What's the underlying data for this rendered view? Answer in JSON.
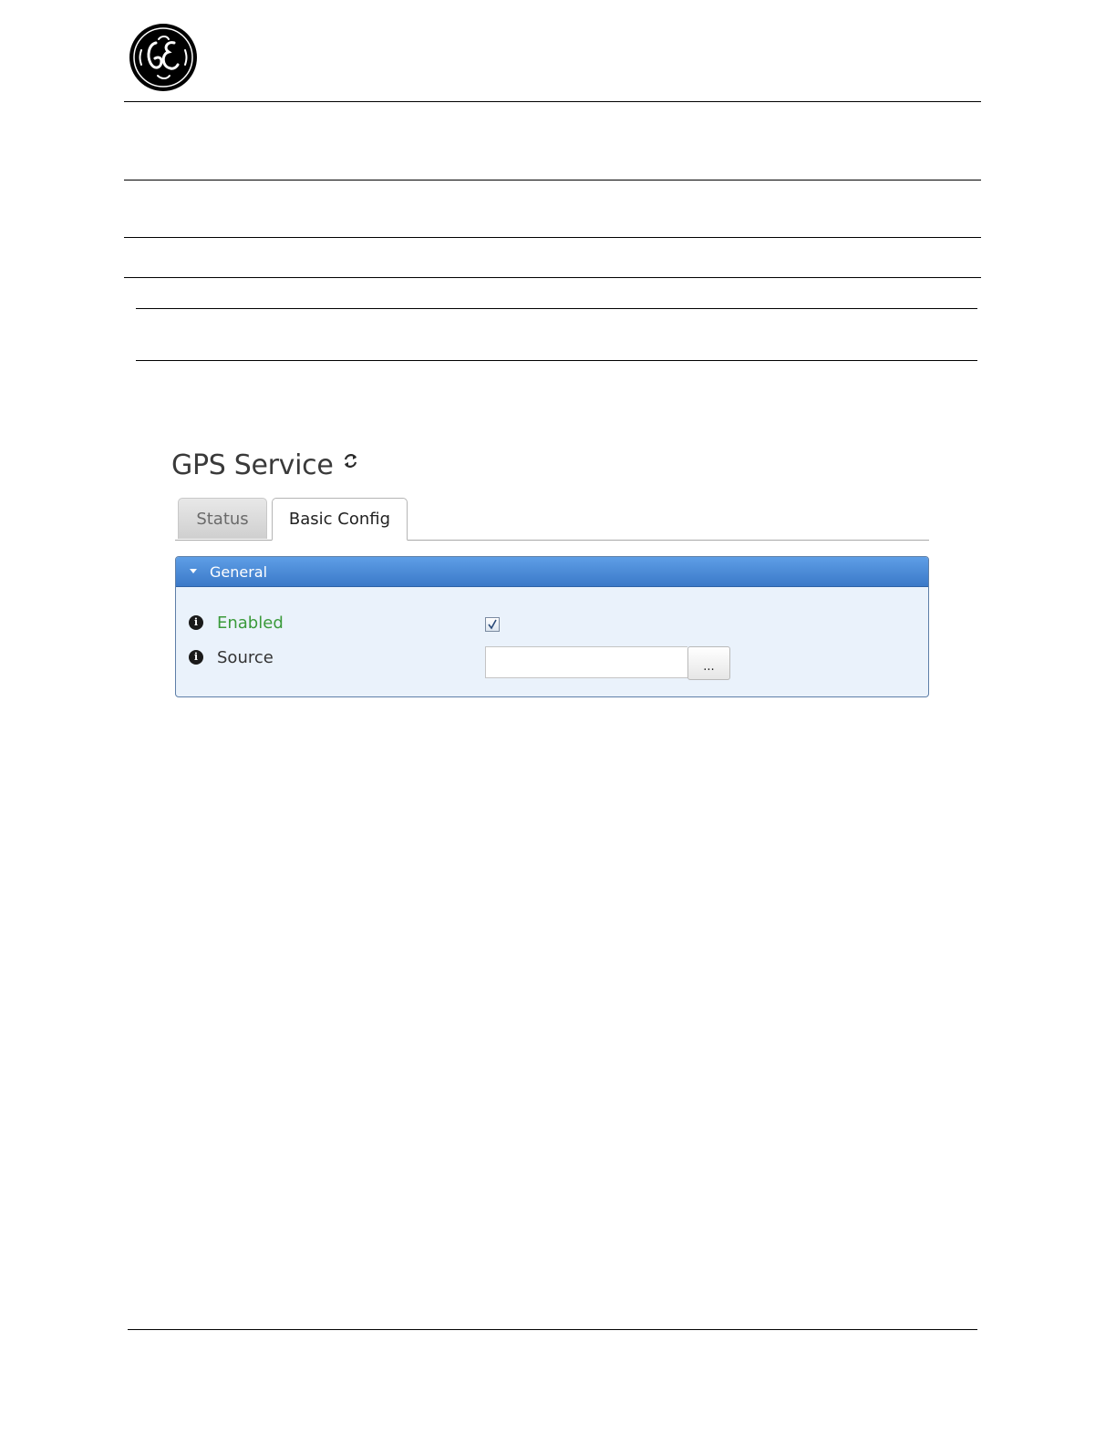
{
  "document": {
    "logo": {
      "icon": "ge-logo-icon",
      "text": "GE"
    }
  },
  "app": {
    "page_title": "GPS Service",
    "refresh_icon": "refresh-icon",
    "tabs": [
      {
        "label": "Status",
        "active": false
      },
      {
        "label": "Basic Config",
        "active": true
      }
    ],
    "panel": {
      "title": "General",
      "expanded": true,
      "header_color": "#4a8ad8",
      "fields": [
        {
          "label": "Enabled",
          "type": "checkbox",
          "checked": true,
          "label_color": "#3a9a3a",
          "icon": "info-icon"
        },
        {
          "label": "Source",
          "type": "text",
          "value": "",
          "button_label": "...",
          "icon": "info-icon"
        }
      ]
    }
  }
}
